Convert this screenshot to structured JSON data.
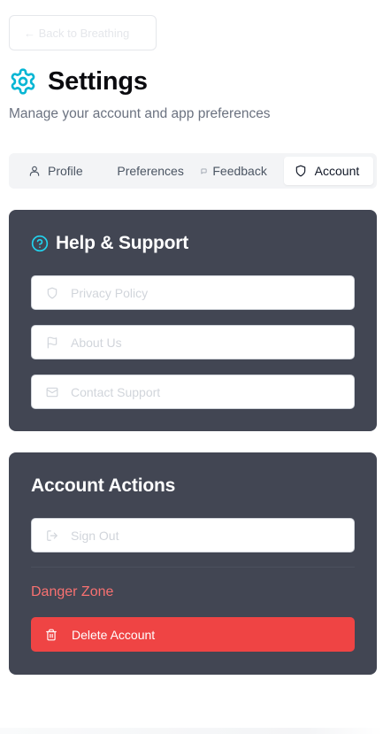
{
  "back": {
    "label": "← Back to Breathing"
  },
  "header": {
    "title": "Settings",
    "subtitle": "Manage your account and app preferences",
    "icon": "gear-icon",
    "accent": "#06b6d4"
  },
  "tabs": [
    {
      "label": "Profile",
      "icon": "user-icon"
    },
    {
      "label": "Preferences",
      "icon": ""
    },
    {
      "label": "Feedback",
      "icon": "message-icon"
    },
    {
      "label": "Account",
      "icon": "shield-icon",
      "active": true
    }
  ],
  "help": {
    "title": "Help & Support",
    "icon": "help-circle-icon",
    "items": [
      {
        "label": "Privacy Policy",
        "icon": "shield-icon"
      },
      {
        "label": "About Us",
        "icon": "flag-icon"
      },
      {
        "label": "Contact Support",
        "icon": "mail-icon"
      }
    ]
  },
  "account_actions": {
    "title": "Account Actions",
    "sign_out": {
      "label": "Sign Out",
      "icon": "log-out-icon"
    },
    "danger_zone_label": "Danger Zone",
    "delete": {
      "label": "Delete Account",
      "icon": "trash-icon"
    }
  },
  "colors": {
    "card_bg": "#424653",
    "danger": "#ef4444",
    "danger_text": "#f87171"
  }
}
